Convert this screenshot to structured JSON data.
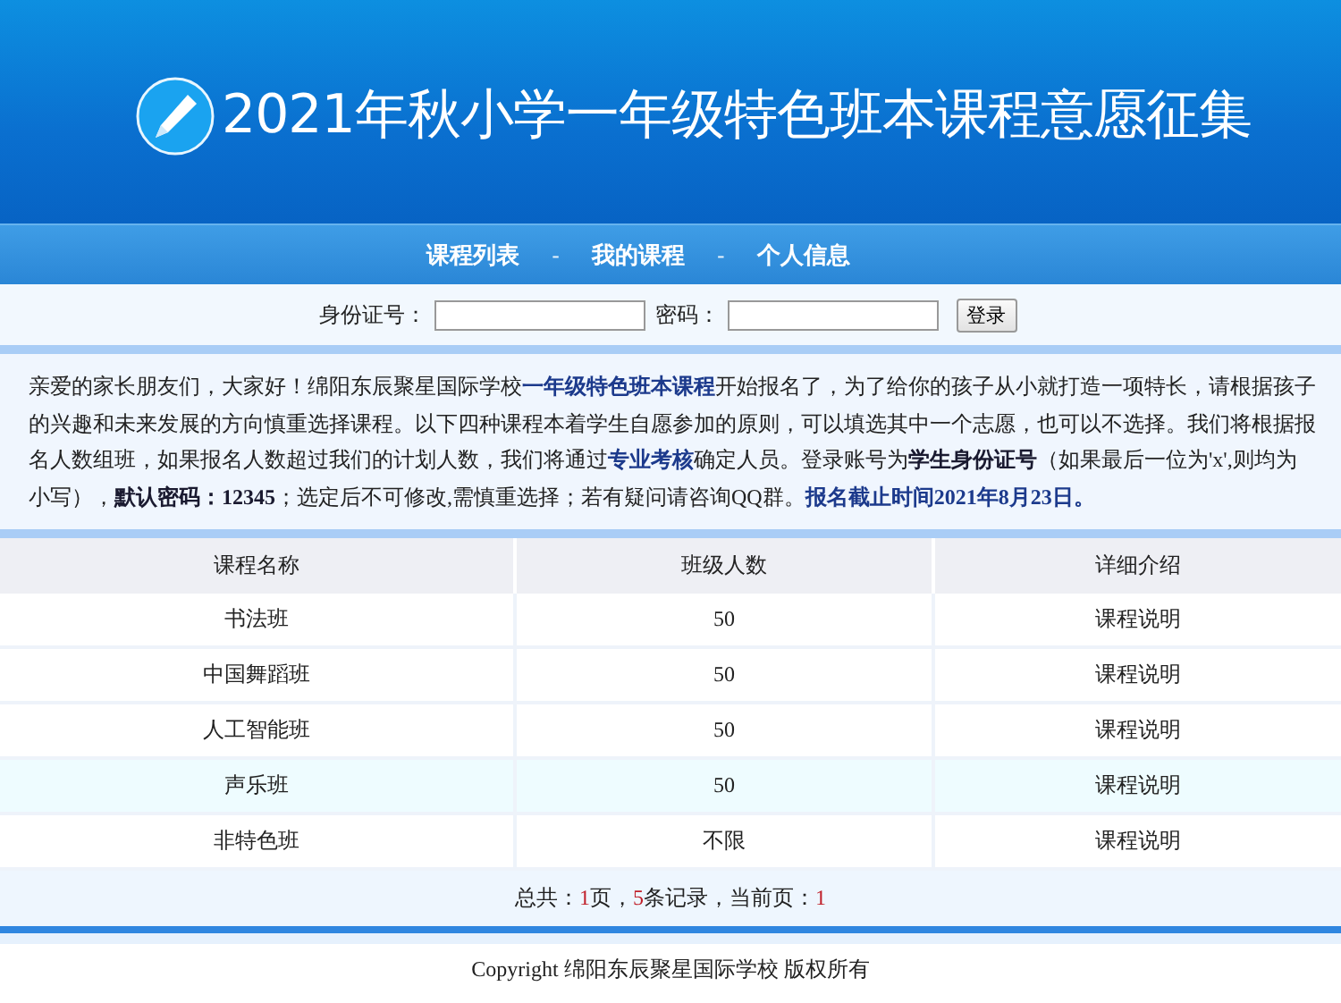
{
  "header": {
    "title": "2021年秋小学一年级特色班本课程意愿征集"
  },
  "nav": {
    "items": [
      {
        "label": "课程列表"
      },
      {
        "label": "我的课程"
      },
      {
        "label": "个人信息"
      }
    ],
    "separator": "-"
  },
  "login": {
    "id_label": "身份证号：",
    "password_label": "密码：",
    "button": "登录"
  },
  "notice": [
    {
      "kind": "plain",
      "text": "亲爱的家长朋友们，大家好！绵阳东辰聚星国际学校"
    },
    {
      "kind": "highlight",
      "text": "一年级特色班本课程"
    },
    {
      "kind": "plain",
      "text": "开始报名了，为了给你的孩子从小就打造一项特长，请根据孩子的兴趣和未来发展的方向慎重选择课程。以下四种课程本着学生自愿参加的原则，可以填选其中一个志愿，也可以不选择。我们将根据报名人数组班，如果报名人数超过我们的计划人数，我们将通过"
    },
    {
      "kind": "highlight",
      "text": "专业考核"
    },
    {
      "kind": "plain",
      "text": "确定人员。登录账号为"
    },
    {
      "kind": "bold",
      "text": "学生身份证号"
    },
    {
      "kind": "plain",
      "text": "（如果最后一位为'x',则均为小写），"
    },
    {
      "kind": "bold",
      "text": "默认密码：12345"
    },
    {
      "kind": "plain",
      "text": "；选定后不可修改,需慎重选择；若有疑问请咨询QQ群。"
    },
    {
      "kind": "highlight",
      "text": "报名截止时间2021年8月23日。"
    }
  ],
  "table": {
    "columns": [
      "课程名称",
      "班级人数",
      "详细介绍"
    ],
    "rows": [
      {
        "name": "书法班",
        "size": "50",
        "detail": "课程说明",
        "highlighted": false
      },
      {
        "name": "中国舞蹈班",
        "size": "50",
        "detail": "课程说明",
        "highlighted": false
      },
      {
        "name": "人工智能班",
        "size": "50",
        "detail": "课程说明",
        "highlighted": false
      },
      {
        "name": "声乐班",
        "size": "50",
        "detail": "课程说明",
        "highlighted": true
      },
      {
        "name": "非特色班",
        "size": "不限",
        "detail": "课程说明",
        "highlighted": false
      }
    ]
  },
  "pager": [
    {
      "kind": "label",
      "text": "总共："
    },
    {
      "kind": "number",
      "text": "1"
    },
    {
      "kind": "label",
      "text": "页，"
    },
    {
      "kind": "number",
      "text": "5"
    },
    {
      "kind": "label",
      "text": "条记录，当前页："
    },
    {
      "kind": "number",
      "text": "1"
    }
  ],
  "footer": {
    "copyright": "Copyright 绵阳东辰聚星国际学校 版权所有"
  }
}
